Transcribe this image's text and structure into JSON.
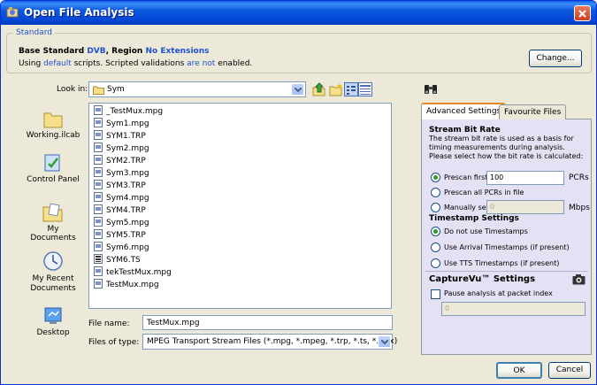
{
  "window": {
    "title": "Open File Analysis"
  },
  "standard": {
    "legend": "Standard",
    "line1_prefix": "Base Standard ",
    "standard_name": "DVB",
    "line1_mid": ", Region ",
    "region": "No Extensions",
    "line2_prefix": "Using ",
    "scripts": "default",
    "line2_mid": " scripts. Scripted validations ",
    "validations": "are not",
    "line2_suffix": " enabled.",
    "change_label": "Change..."
  },
  "lookin": {
    "label": "Look in:",
    "value": "Sym"
  },
  "places": [
    {
      "label": "Working.ilcab"
    },
    {
      "label": "Control Panel"
    },
    {
      "label": "My Documents"
    },
    {
      "label": "My Recent Documents"
    },
    {
      "label": "Desktop"
    }
  ],
  "files": [
    "_TestMux.mpg",
    "Sym1.mpg",
    "SYM1.TRP",
    "Sym2.mpg",
    "SYM2.TRP",
    "Sym3.mpg",
    "SYM3.TRP",
    "Sym4.mpg",
    "SYM4.TRP",
    "Sym5.mpg",
    "SYM5.TRP",
    "Sym6.mpg",
    "SYM6.TS",
    "tekTestMux.mpg",
    "TestMux.mpg"
  ],
  "file_name": {
    "label": "File name:",
    "value": "TestMux.mpg"
  },
  "file_type": {
    "label": "Files of type:",
    "value": "MPEG Transport Stream Files (*.mpg, *.mpeg, *.trp, *.ts, *.rmx)"
  },
  "tabs": {
    "advanced": "Advanced Settings",
    "favourites": "Favourite Files"
  },
  "advanced": {
    "bitrate_title": "Stream Bit Rate",
    "bitrate_desc": "The stream bit rate is used as a basis for timing measurements during analysis. Please select how the bit rate is calculated:",
    "prescan_first": "Prescan first",
    "prescan_value": "100",
    "pcrs_unit": "PCRs",
    "prescan_all": "Prescan all PCRs in file",
    "manual": "Manually set",
    "manual_value": "0",
    "mbps_unit": "Mbps",
    "timestamp_title": "Timestamp Settings",
    "ts_none": "Do not use Timestamps",
    "ts_arrival": "Use Arrival Timestamps (if present)",
    "ts_tts": "Use TTS Timestamps (if present)",
    "capturevu_title": "CaptureVu™ Settings",
    "pause_label": "Pause analysis at packet index",
    "pause_value": "0"
  },
  "buttons": {
    "ok": "OK",
    "cancel": "Cancel"
  },
  "colors": {
    "title_blue": "#0a58df",
    "accent_blue": "#1f52d1",
    "panel": "#e3e1f3"
  }
}
